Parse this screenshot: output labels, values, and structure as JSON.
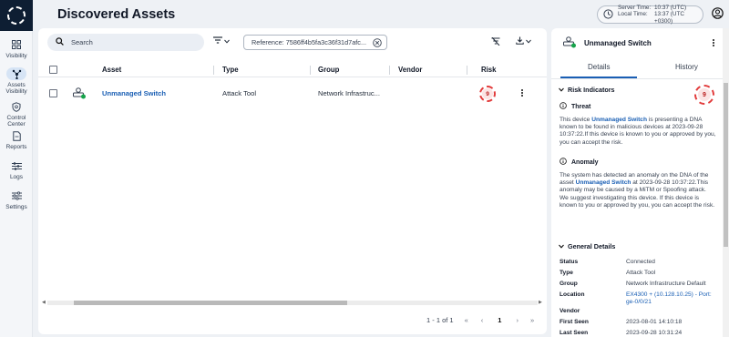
{
  "page": {
    "title": "Discovered Assets"
  },
  "server_time": {
    "server_label": "Server Time:",
    "server_value": "10:37 (UTC)",
    "local_label": "Local Time:",
    "local_value": "13:37 (UTC +0300)"
  },
  "nav": [
    {
      "label": "Visibility",
      "icon": "grid-icon"
    },
    {
      "label": "Assets Visibility",
      "icon": "assets-icon",
      "active": true
    },
    {
      "label": "Control Center",
      "icon": "shield-icon"
    },
    {
      "label": "Reports",
      "icon": "report-icon"
    },
    {
      "label": "Logs",
      "icon": "logs-icon"
    },
    {
      "label": "Settings",
      "icon": "settings-icon"
    }
  ],
  "toolbar": {
    "search_placeholder": "Search",
    "filter_chip": "Reference: 7586ff4b5fa3c36f31d7afc..."
  },
  "table": {
    "columns": [
      "Asset",
      "Type",
      "Group",
      "Vendor",
      "Risk"
    ],
    "rows": [
      {
        "asset": "Unmanaged Switch",
        "type": "Attack Tool",
        "group": "Network Infrastruc...",
        "vendor": "",
        "risk": "9"
      }
    ]
  },
  "pagination": {
    "range": "1 - 1 of 1",
    "page": "1"
  },
  "panel": {
    "title": "Unmanaged Switch",
    "tabs": [
      "Details",
      "History"
    ],
    "risk": "9",
    "risk_indicators_label": "Risk Indicators",
    "threat": {
      "label": "Threat",
      "pre": "This device ",
      "asset": "Unmanaged Switch",
      "post": " is presenting a DNA known to be found in malicious devices at 2023-09-28 10:37:22.If this device is known to you or approved by you, you can accept the risk."
    },
    "anomaly": {
      "label": "Anomaly",
      "pre": "The system has detected an anomaly on the DNA of the asset ",
      "asset": "Unmanaged Switch",
      "post": " at 2023-09-28 10:37:22.This anomaly may be caused by a MiTM or Spoofing attack. We suggest investigating this device. If this device is known to you or approved by you, you can accept the risk."
    },
    "general_details_label": "General Details",
    "details": [
      {
        "key": "Status",
        "value": "Connected"
      },
      {
        "key": "Type",
        "value": "Attack Tool"
      },
      {
        "key": "Group",
        "value": "Network Infrastructure Default"
      },
      {
        "key": "Location",
        "value": "EX4300 + (10.128.10.25) - Port: ge-0/0/21",
        "link": true
      },
      {
        "key": "Vendor",
        "value": ""
      },
      {
        "key": "First Seen",
        "value": "2023-08-01 14:10:18"
      },
      {
        "key": "Last Seen",
        "value": "2023-09-28 10:31:24"
      }
    ]
  },
  "colors": {
    "accent": "#1a5fb4",
    "risk": "#e23b3b",
    "logo_bg": "#0e1e33"
  }
}
